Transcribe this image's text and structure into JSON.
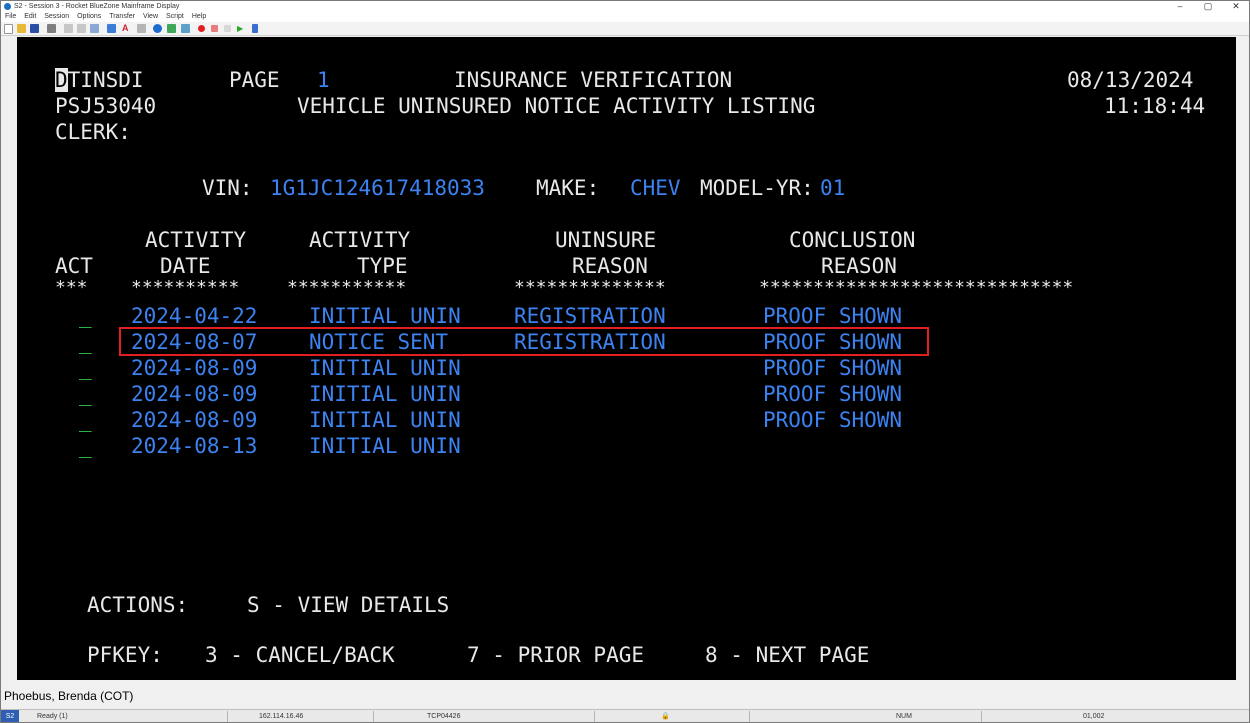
{
  "window": {
    "title": "S2 - Session 3 - Rocket BlueZone Mainframe Display",
    "controls": {
      "minimize": "–",
      "maximize": "▢",
      "close": "✕"
    }
  },
  "menu": [
    "File",
    "Edit",
    "Session",
    "Options",
    "Transfer",
    "View",
    "Script",
    "Help"
  ],
  "toolbar_icons": [
    "new-icon",
    "open-icon",
    "save-icon",
    "print-icon",
    "cut-icon",
    "copy-icon",
    "paste-icon",
    "connect-icon",
    "font-icon",
    "clear-icon",
    "web-icon",
    "transfer-icon",
    "macro-icon",
    "record-icon",
    "stop-icon",
    "pause-icon",
    "play-icon",
    "script-icon"
  ],
  "terminal": {
    "cursor_char": "D",
    "header": {
      "screen_id_rest": "TINSDI",
      "page_label": "PAGE",
      "page_num": "1",
      "title": "INSURANCE VERIFICATION",
      "date": "08/13/2024",
      "program": "PSJ53040",
      "subtitle": "VEHICLE UNINSURED NOTICE ACTIVITY LISTING",
      "time": "11:18:44",
      "clerk_label": "CLERK:"
    },
    "vehicle": {
      "vin_label": "VIN:",
      "vin": "1G1JC124617418033",
      "make_label": "MAKE:",
      "make": "CHEV",
      "model_label": "MODEL-YR:",
      "model_yr": "01"
    },
    "columns": {
      "act": "ACT",
      "activity_date_1": "ACTIVITY",
      "activity_date_2": "DATE",
      "activity_type_1": "ACTIVITY",
      "activity_type_2": "TYPE",
      "uninsure_1": "UNINSURE",
      "uninsure_2": "REASON",
      "conclusion_1": "CONCLUSION",
      "conclusion_2": "REASON",
      "stars_act": "***",
      "stars_date": "**********",
      "stars_type": "***********",
      "stars_reason": "**************",
      "stars_conclusion": "*****************************"
    },
    "rows": [
      {
        "act": "_",
        "date": "2024-04-22",
        "type": "INITIAL UNIN",
        "reason": "REGISTRATION",
        "conclusion": "PROOF SHOWN"
      },
      {
        "act": "_",
        "date": "2024-08-07",
        "type": "NOTICE SENT",
        "reason": "REGISTRATION",
        "conclusion": "PROOF SHOWN"
      },
      {
        "act": "_",
        "date": "2024-08-09",
        "type": "INITIAL UNIN",
        "reason": "",
        "conclusion": "PROOF SHOWN"
      },
      {
        "act": "_",
        "date": "2024-08-09",
        "type": "INITIAL UNIN",
        "reason": "",
        "conclusion": "PROOF SHOWN"
      },
      {
        "act": "_",
        "date": "2024-08-09",
        "type": "INITIAL UNIN",
        "reason": "",
        "conclusion": "PROOF SHOWN"
      },
      {
        "act": "_",
        "date": "2024-08-13",
        "type": "INITIAL UNIN",
        "reason": "",
        "conclusion": ""
      }
    ],
    "actions_label": "ACTIONS:",
    "actions_text": "S - VIEW DETAILS",
    "pfkey_label": "PFKEY:",
    "pfkeys": [
      "3 - CANCEL/BACK",
      "7 - PRIOR PAGE",
      "8 - NEXT PAGE"
    ]
  },
  "user_label": "Phoebus, Brenda (COT)",
  "status": {
    "session": "S2",
    "state": "Ready (1)",
    "ip": "162.114.16.46",
    "terminal": "TCP04426",
    "lock": "🔒",
    "num": "NUM",
    "position": "01,002"
  },
  "colors": {
    "screen_bg": "#000000",
    "field_text": "#3c82f0",
    "protected_text": "#e8e8e8",
    "input_marker": "#2fd44a",
    "highlight_box": "#e41e1e"
  }
}
